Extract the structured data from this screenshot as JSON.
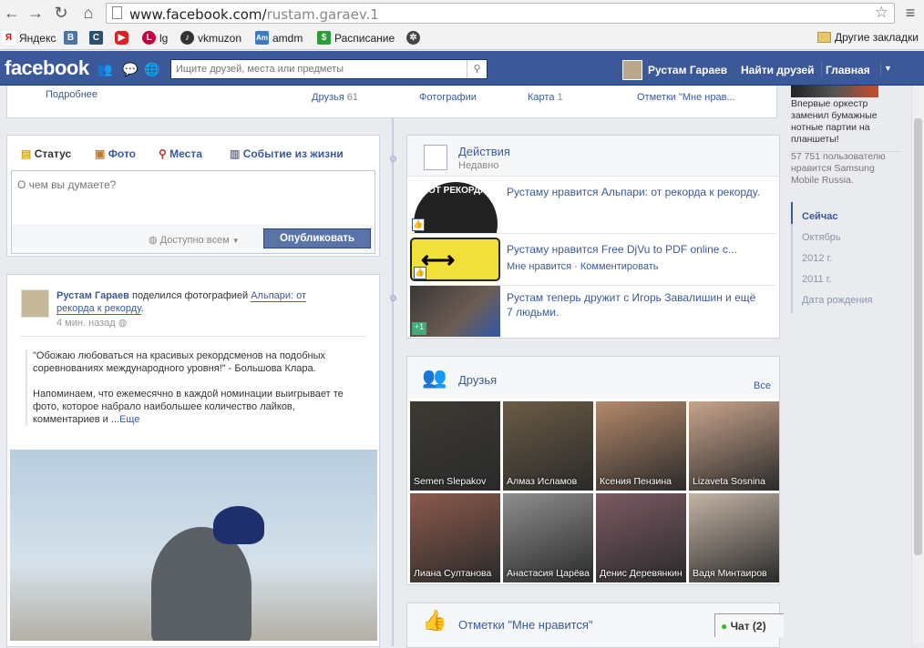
{
  "browser": {
    "url_host": "www.facebook.com/",
    "url_path": "rustam.garaev.1",
    "bookmarks": [
      "Яндекс",
      "",
      "",
      "",
      "lg",
      "vkmuzon",
      "amdm",
      "Расписание",
      ""
    ],
    "other_bookmarks": "Другие закладки"
  },
  "header": {
    "logo": "facebook",
    "search_placeholder": "Ищите друзей, места или предметы",
    "user_name": "Рустам Гараев",
    "find_friends": "Найти друзей",
    "home": "Главная"
  },
  "profile_tabs": {
    "more": "Подробнее",
    "friends": "Друзья",
    "friends_count": "61",
    "photos": "Фотографии",
    "map": "Карта",
    "map_count": "1",
    "likes": "Отметки \"Мне нрав..."
  },
  "composer": {
    "tabs": [
      "Статус",
      "Фото",
      "Места",
      "Событие из жизни"
    ],
    "placeholder": "О чем вы думаете?",
    "privacy": "Доступно всем",
    "post_button": "Опубликовать"
  },
  "post": {
    "author": "Рустам Гараев",
    "action": "поделился фотографией",
    "target_line1": "Альпари: от",
    "target_line2": "рекорда к рекорду",
    "time": "4 мин. назад",
    "quote": "\"Обожаю любоваться на красивых рекордсменов на подобных соревнованиях международного уровня!\" - Большова Клара.",
    "text": "Напоминаем, что ежемесячно в каждой номинации выигрывает те фото, которое набрало наибольшее количество лайков, комментариев и ...",
    "more": "Еще"
  },
  "activity": {
    "title": "Действия",
    "subtitle": "Недавно",
    "items": [
      {
        "text": "Рустаму нравится Альпари: от рекорда к рекорду.",
        "sub": "",
        "thumb_label": "ОТ РЕКОРДА"
      },
      {
        "text": "Рустаму нравится Free DjVu to PDF online c...",
        "sub": "Мне нравится · Комментировать",
        "thumb_label": ""
      },
      {
        "text": "Рустам теперь дружит с Игорь Завалишин и ещё 7 людьми.",
        "sub": "",
        "thumb_label": "+1"
      }
    ]
  },
  "friends": {
    "title": "Друзья",
    "all": "Все",
    "list": [
      {
        "name": "Semen Slepakov",
        "color": "#3d3a33"
      },
      {
        "name": "Алмаз Исламов",
        "color": "#6b5b45"
      },
      {
        "name": "Ксения Пензина",
        "color": "#b5896a"
      },
      {
        "name": "Lizaveta Sosnina",
        "color": "#c9a48c"
      },
      {
        "name": "Лиана Султанова",
        "color": "#8c5a4c"
      },
      {
        "name": "Анастасия Царёва",
        "color": "#8e8e8e"
      },
      {
        "name": "Денис Деревянкин",
        "color": "#7c5a63"
      },
      {
        "name": "Вадя Минтаиров",
        "color": "#c4b3a4"
      }
    ]
  },
  "likes_box": {
    "title": "Отметки \"Мне нравится\""
  },
  "chat": {
    "label": "Чат",
    "count": "(2)"
  },
  "sidebar": {
    "ad_text": "Впервые оркестр заменил бумажные нотные партии на планшеты!",
    "ad_likes": "57 751 пользователю нравится Samsung Mobile Russia.",
    "timeline": [
      "Сейчас",
      "Октябрь",
      "2012 г.",
      "2011 г.",
      "Дата рождения"
    ]
  }
}
